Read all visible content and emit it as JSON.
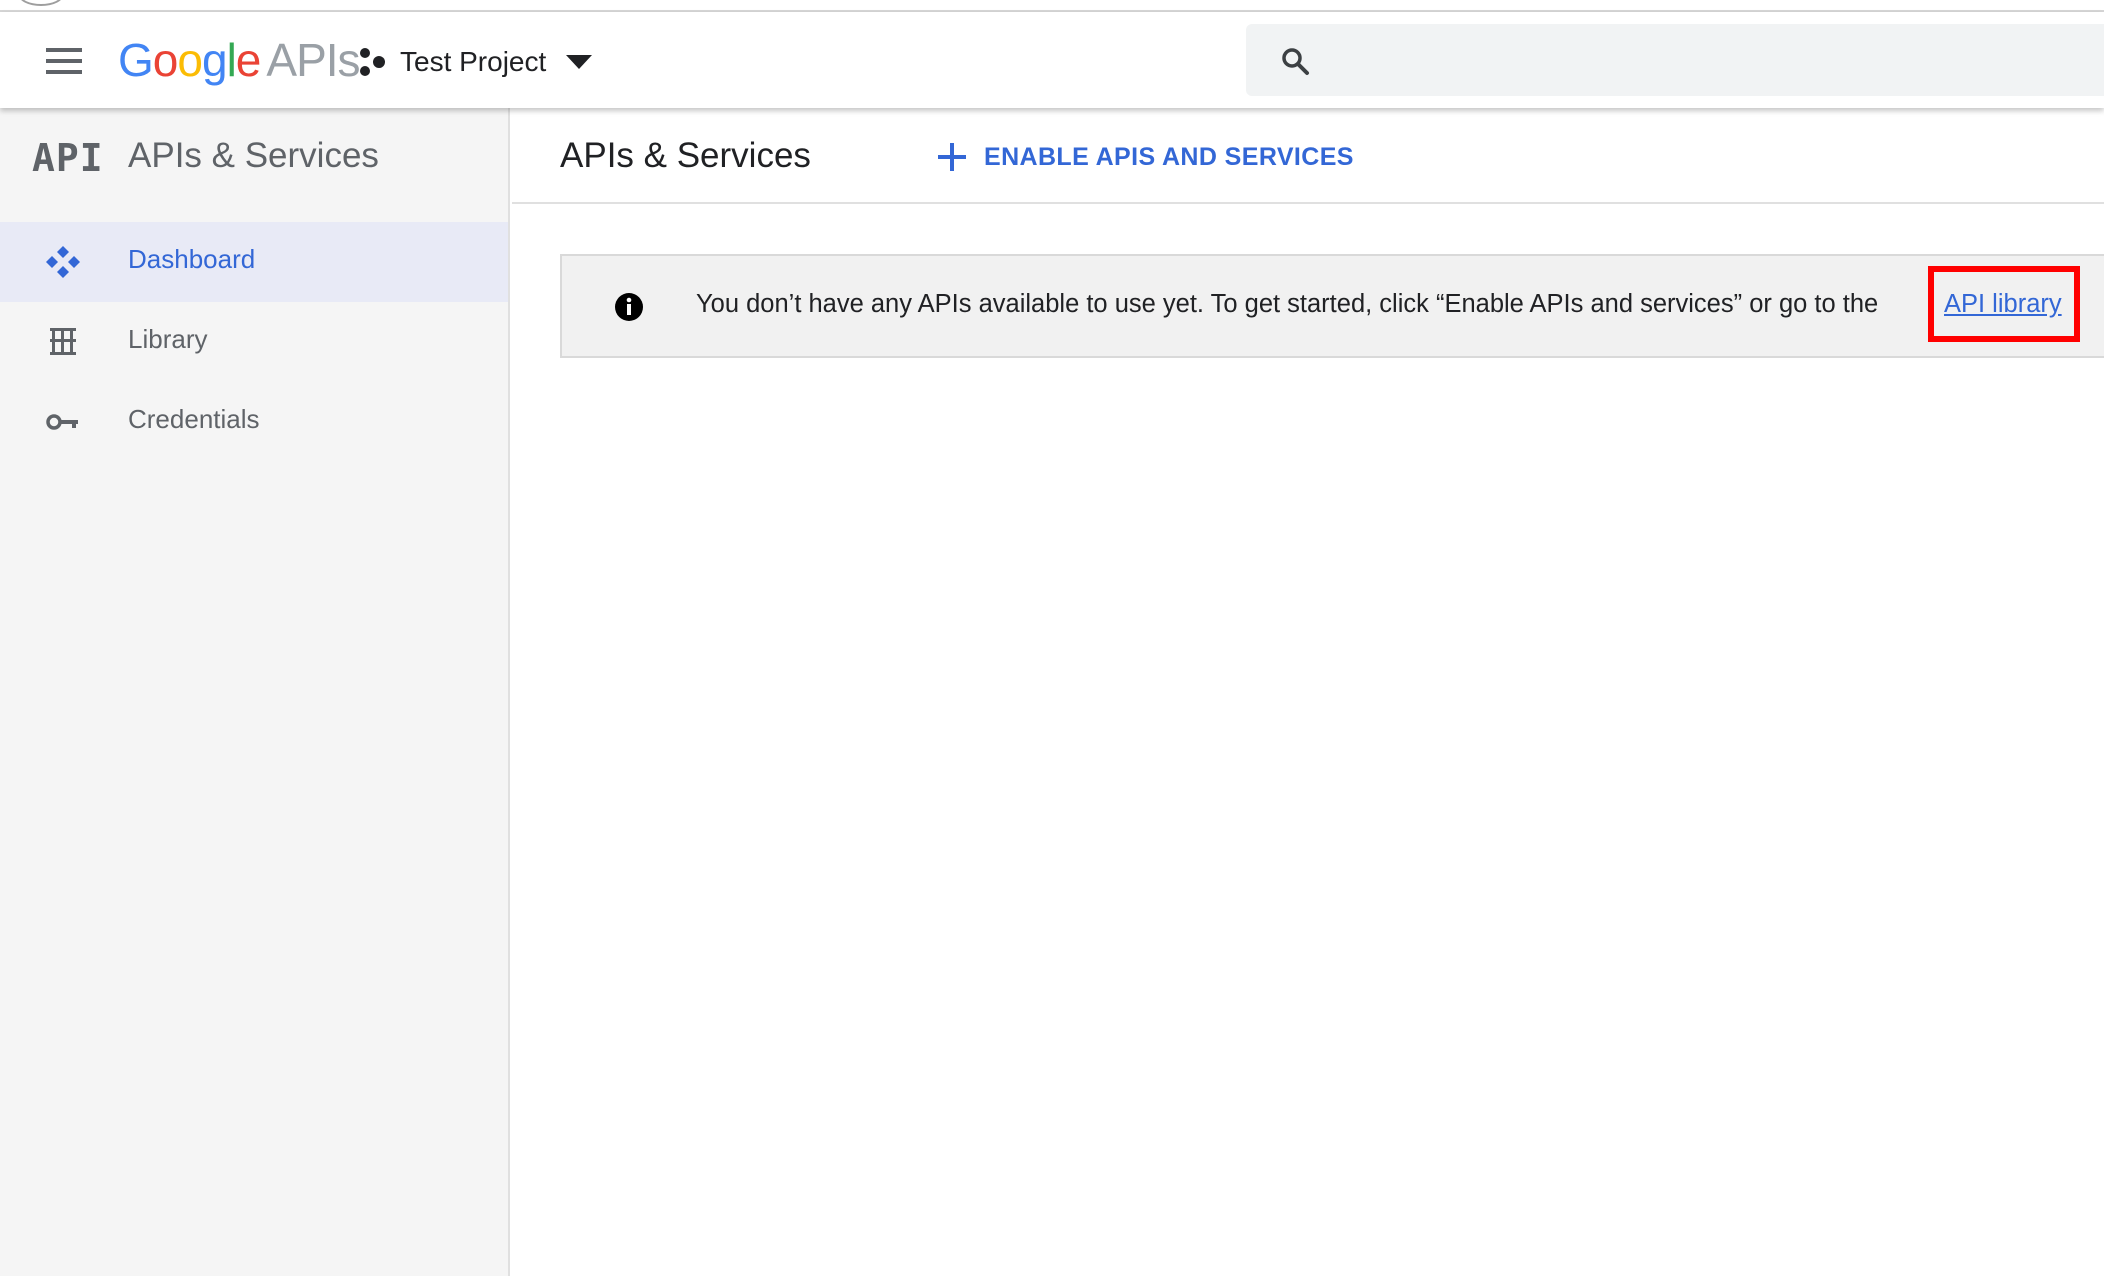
{
  "header": {
    "logo": {
      "google_letters": [
        "G",
        "o",
        "o",
        "g",
        "l",
        "e"
      ],
      "apis": "APIs"
    },
    "project": {
      "name": "Test Project"
    },
    "search": {
      "placeholder": ""
    }
  },
  "sidebar": {
    "logo_text": "API",
    "title": "APIs & Services",
    "items": [
      {
        "label": "Dashboard",
        "icon": "dashboard-icon",
        "active": true
      },
      {
        "label": "Library",
        "icon": "library-icon",
        "active": false
      },
      {
        "label": "Credentials",
        "icon": "key-icon",
        "active": false
      }
    ]
  },
  "main": {
    "title": "APIs & Services",
    "enable_button": "ENABLE APIS AND SERVICES",
    "banner": {
      "text": "You don’t have any APIs available to use yet. To get started, click “Enable APIs and services” or go to the",
      "link": "API library"
    }
  },
  "colors": {
    "accent": "#3367d6",
    "sidebar_bg": "#f5f5f5",
    "active_bg": "#e8eaf6",
    "highlight": "#ff0000"
  }
}
